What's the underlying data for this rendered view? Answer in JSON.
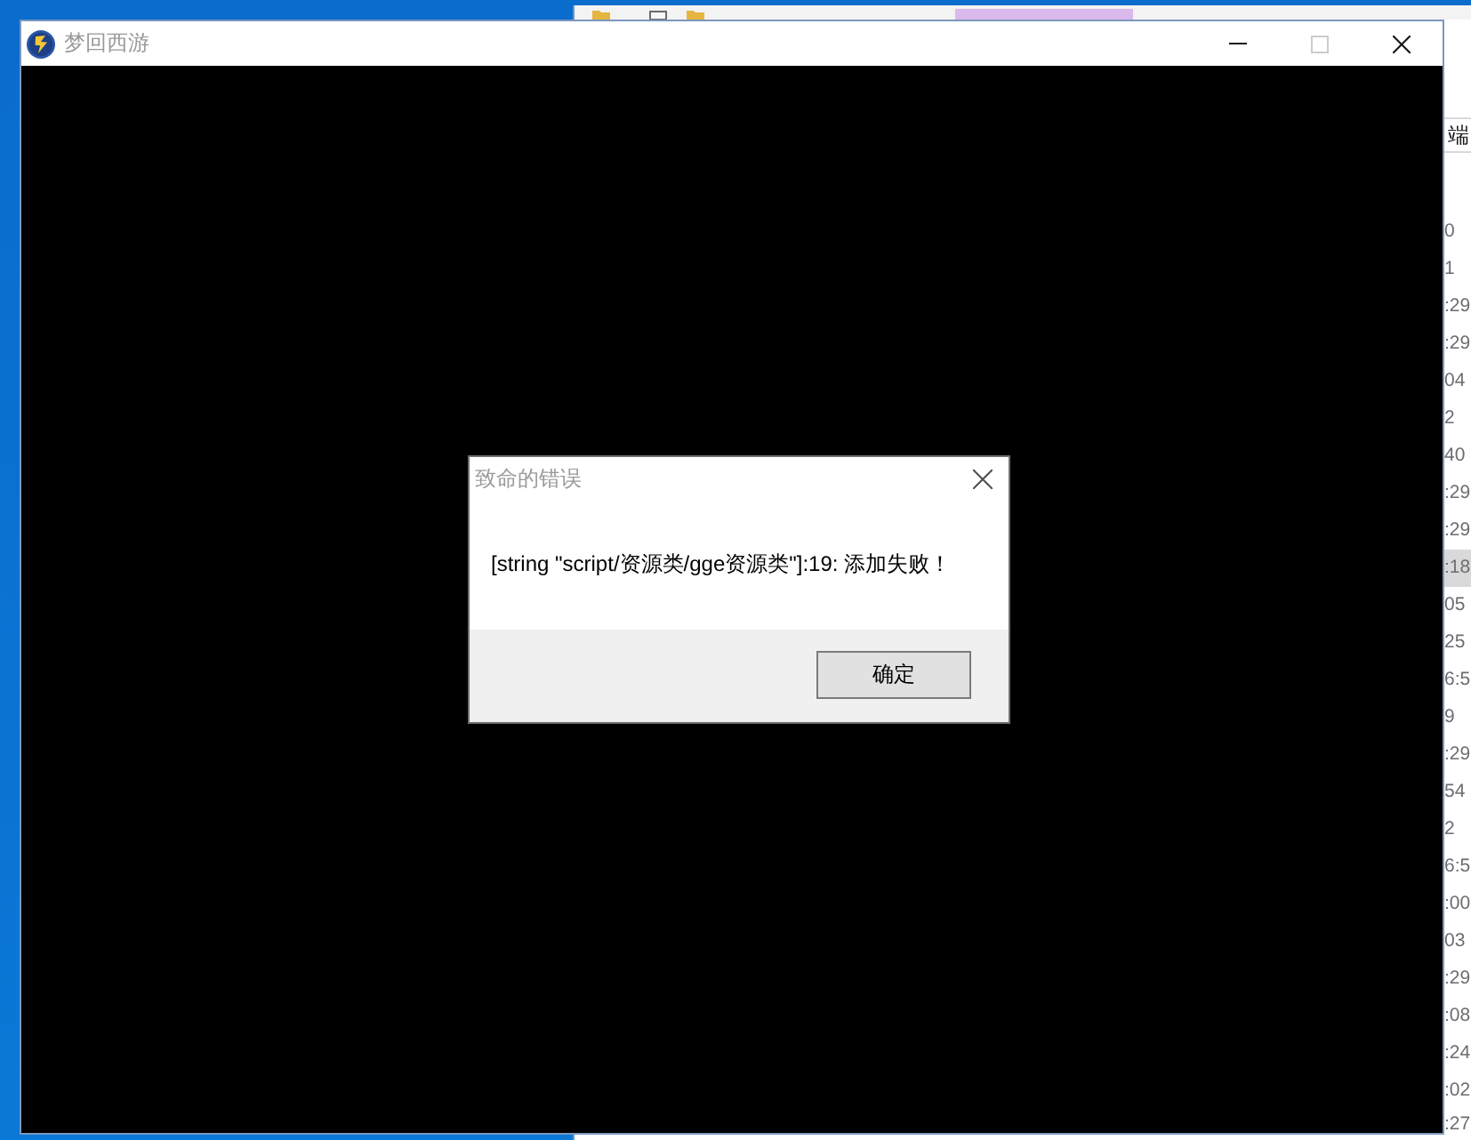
{
  "main_window": {
    "title": "梦回西游",
    "title_buttons": [
      {
        "kind": "minimize",
        "disabled": false
      },
      {
        "kind": "maximize",
        "disabled": true
      },
      {
        "kind": "close",
        "disabled": false
      }
    ]
  },
  "dialog": {
    "title": "致命的错误",
    "message": "[string \"script/资源类/gge资源类\"]:19: 添加失败！",
    "buttons": [
      {
        "label": "确定"
      }
    ]
  },
  "background_window": {
    "address_bar": {
      "value": "端"
    },
    "rows": [
      {
        "text": "0",
        "selected": false
      },
      {
        "text": "1",
        "selected": false
      },
      {
        "text": ":29",
        "selected": false
      },
      {
        "text": ":29",
        "selected": false
      },
      {
        "text": "04",
        "selected": false
      },
      {
        "text": "2",
        "selected": false
      },
      {
        "text": "40",
        "selected": false
      },
      {
        "text": ":29",
        "selected": false
      },
      {
        "text": ":29",
        "selected": false
      },
      {
        "text": ":18",
        "selected": true
      },
      {
        "text": "05",
        "selected": false
      },
      {
        "text": "25",
        "selected": false
      },
      {
        "text": "6:5",
        "selected": false
      },
      {
        "text": "9",
        "selected": false
      },
      {
        "text": ":29",
        "selected": false
      },
      {
        "text": "54",
        "selected": false
      },
      {
        "text": "2",
        "selected": false
      },
      {
        "text": "6:5",
        "selected": false
      },
      {
        "text": ":00",
        "selected": false
      },
      {
        "text": "03",
        "selected": false
      },
      {
        "text": ":29",
        "selected": false
      },
      {
        "text": ":08",
        "selected": false
      },
      {
        "text": ":24",
        "selected": false
      },
      {
        "text": ":02",
        "selected": false
      },
      {
        "text": ":27",
        "selected": false
      }
    ]
  }
}
